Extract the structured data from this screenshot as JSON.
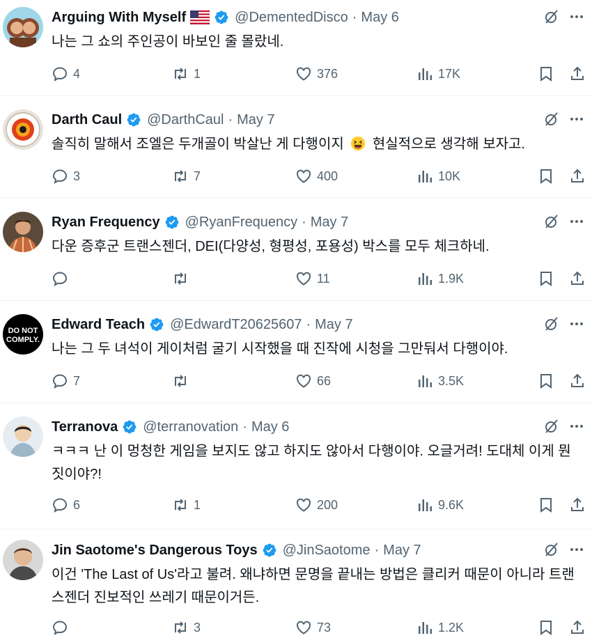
{
  "tweets": [
    {
      "name": "Arguing With Myself",
      "flag_icon": "us-flag-icon",
      "verified": true,
      "handle": "@DementedDisco",
      "sep": "·",
      "date": "May 6",
      "text": "나는 그 쇼의 주인공이 바보인 줄 몰랐네.",
      "replies": "4",
      "reposts": "1",
      "likes": "376",
      "views": "17K"
    },
    {
      "name": "Darth Caul",
      "verified": true,
      "handle": "@DarthCaul",
      "sep": "·",
      "date": "May 7",
      "text_before": "솔직히 말해서 조엘은 두개골이 박살난 게 다행이지",
      "emoji": "grinning-squinting-face-icon",
      "text_after": "현실적으로 생각해 보자고.",
      "replies": "3",
      "reposts": "7",
      "likes": "400",
      "views": "10K"
    },
    {
      "name": "Ryan Frequency",
      "verified": true,
      "handle": "@RyanFrequency",
      "sep": "·",
      "date": "May 7",
      "text": "다운 증후군 트랜스젠더, DEI(다양성, 형평성, 포용성) 박스를 모두 체크하네.",
      "replies": "",
      "reposts": "",
      "likes": "11",
      "views": "1.9K"
    },
    {
      "name": "Edward Teach",
      "verified": true,
      "handle": "@EdwardT20625607",
      "sep": "·",
      "date": "May 7",
      "avatar_text_1": "DO NOT",
      "avatar_text_2": "COMPLY.",
      "text": "나는 그 두 녀석이 게이처럼 굴기 시작했을 때 진작에 시청을 그만둬서 다행이야.",
      "replies": "7",
      "reposts": "",
      "likes": "66",
      "views": "3.5K"
    },
    {
      "name": "Terranova",
      "verified": true,
      "handle": "@terranovation",
      "sep": "·",
      "date": "May 6",
      "text": "ㅋㅋㅋ 난 이 멍청한 게임을 보지도 않고 하지도 않아서 다행이야. 오글거려! 도대체 이게 뭔 짓이야?!",
      "replies": "6",
      "reposts": "1",
      "likes": "200",
      "views": "9.6K"
    },
    {
      "name": "Jin Saotome's Dangerous Toys",
      "verified": true,
      "handle": "@JinSaotome",
      "sep": "·",
      "date": "May 7",
      "text": "이건 'The Last of Us'라고 불려. 왜냐하면 문명을 끝내는 방법은 클리커 때문이 아니라 트랜스젠더 진보적인 쓰레기 때문이거든.",
      "replies": "",
      "reposts": "3",
      "likes": "73",
      "views": "1.2K"
    }
  ],
  "colors": {
    "text": "#0f1419",
    "secondary": "#536471",
    "verified": "#1d9bf0",
    "border": "#eff3f4"
  }
}
